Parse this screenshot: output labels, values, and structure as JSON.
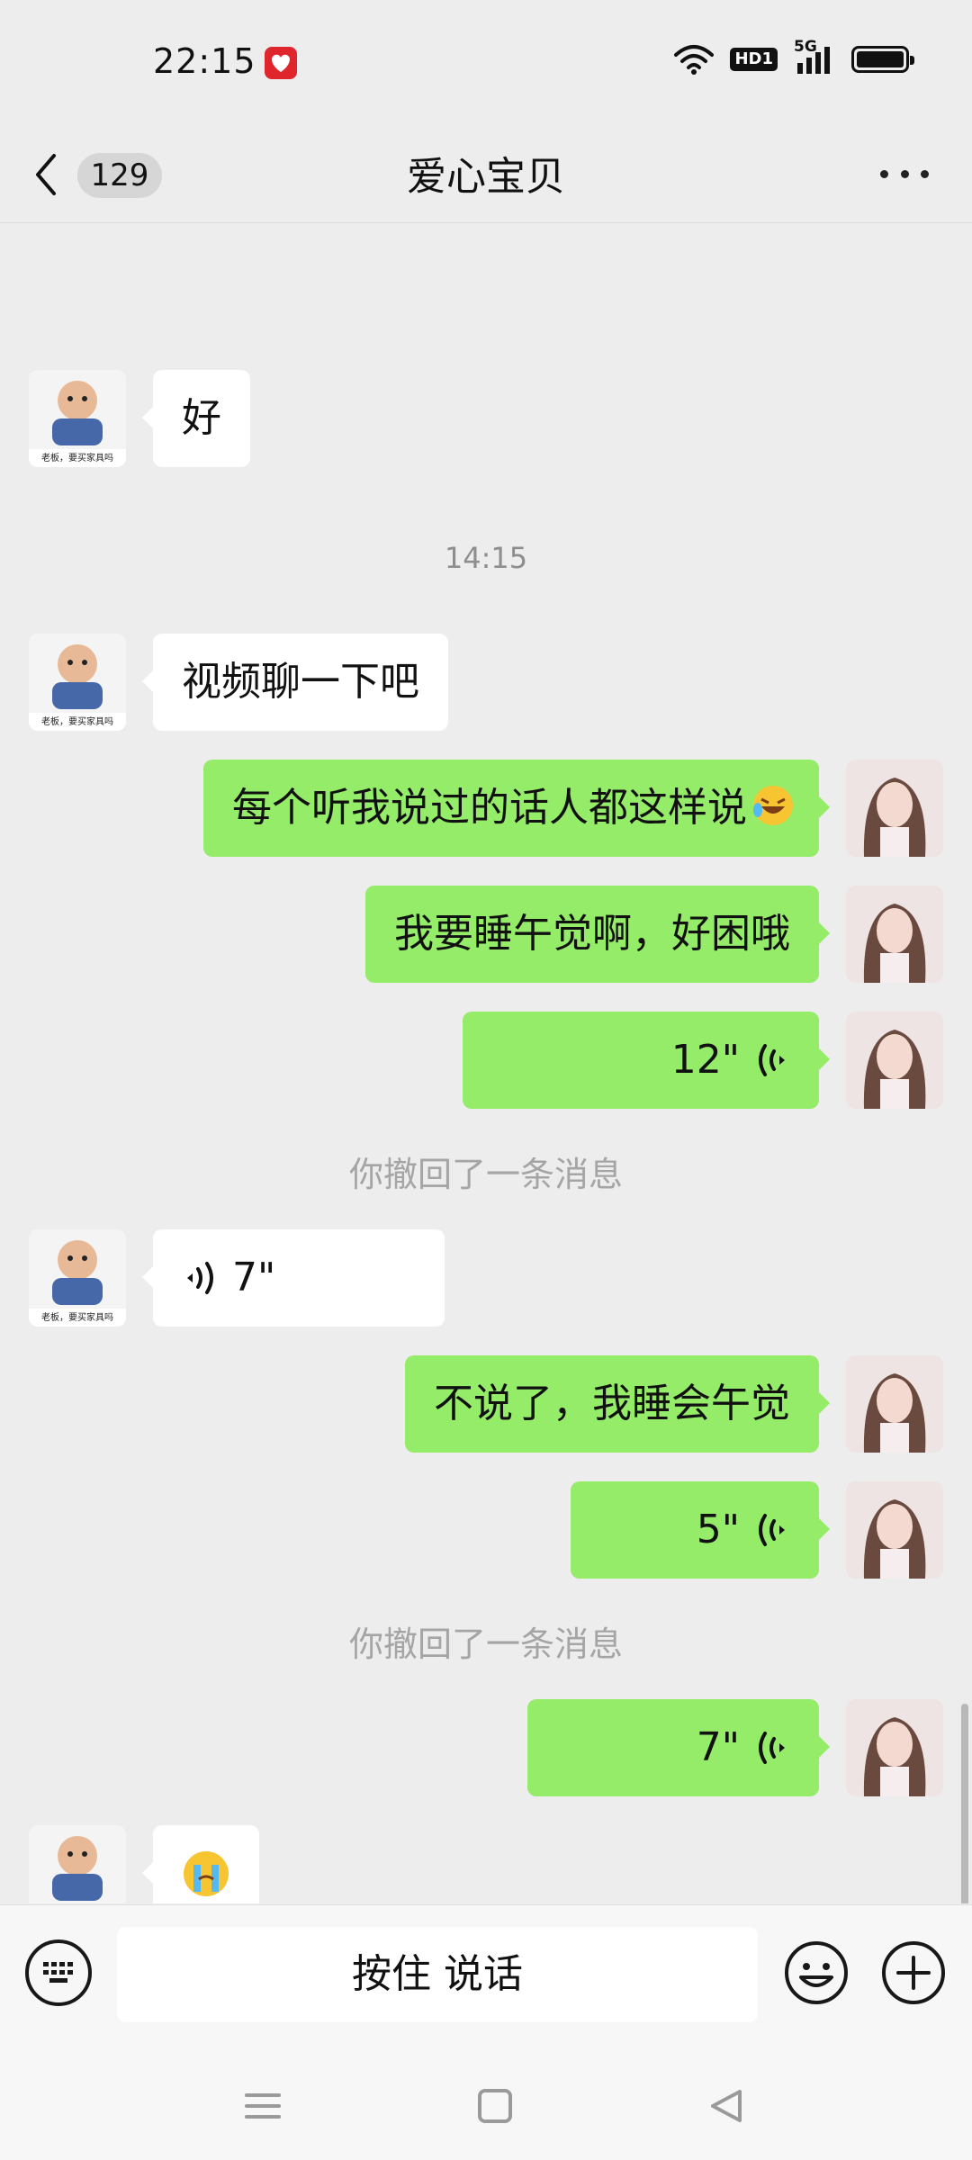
{
  "status_bar": {
    "time": "22:15",
    "network": "5G",
    "hd_label": "HD1"
  },
  "nav": {
    "unread_count": "129",
    "title": "爱心宝贝",
    "more_icon": "more-dots-icon"
  },
  "messages": {
    "m1_text": "好",
    "time_1415": "14:15",
    "m2_text": "视频聊一下吧",
    "m3_text": "每个听我说过的话人都这样说",
    "m4_text": "我要睡午觉啊，好困哦",
    "m5_duration": "12\"",
    "recall_1": "你撤回了一条消息",
    "m6_duration": "7\"",
    "m7_text": "不说了，我睡会午觉",
    "m8_duration": "5\"",
    "recall_2": "你撤回了一条消息",
    "m9_duration": "7\""
  },
  "avatar_caption": "老板，要买家具吗",
  "input_bar": {
    "hold_to_talk": "按住 说话"
  },
  "colors": {
    "outgoing_bubble": "#95ec69",
    "incoming_bubble": "#ffffff",
    "background": "#ededed"
  }
}
